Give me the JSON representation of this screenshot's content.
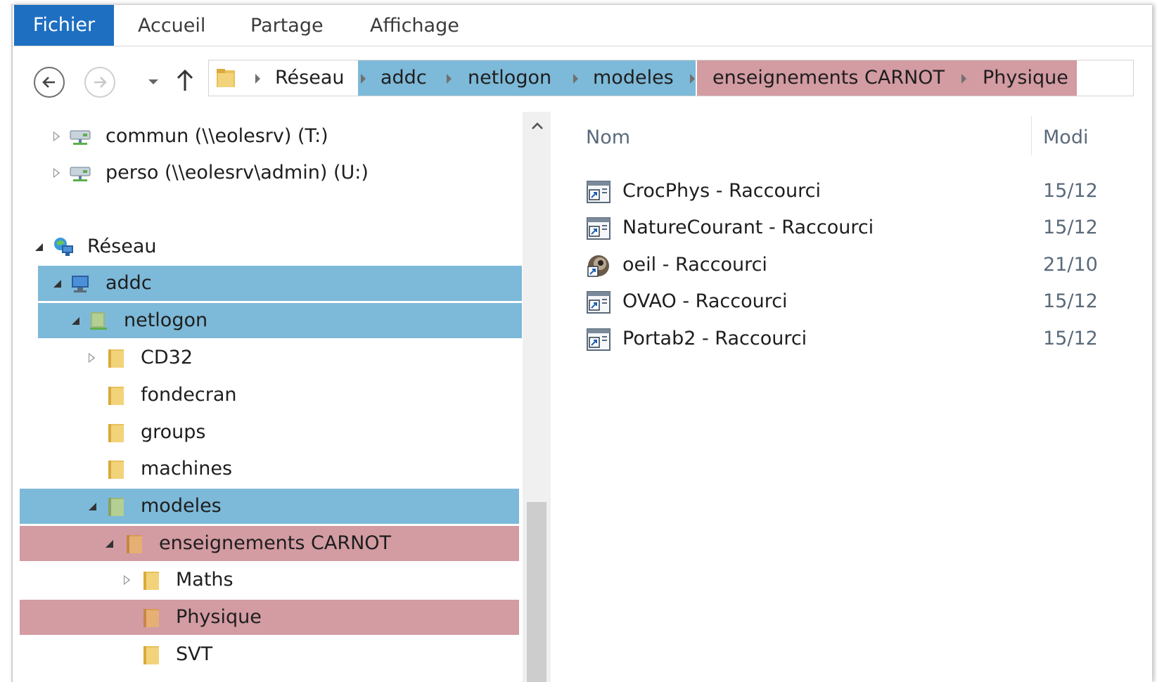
{
  "ribbon": {
    "tabs": [
      {
        "label": "Fichier"
      },
      {
        "label": "Accueil"
      },
      {
        "label": "Partage"
      },
      {
        "label": "Affichage"
      }
    ]
  },
  "address": {
    "crumbs": [
      "Réseau",
      "addc",
      "netlogon",
      "modeles",
      "enseignements CARNOT",
      "Physique"
    ]
  },
  "tree": {
    "items": [
      {
        "label": "commun (\\\\eolesrv) (T:)"
      },
      {
        "label": "perso (\\\\eolesrv\\admin) (U:)"
      },
      {
        "label": "Réseau"
      },
      {
        "label": "addc"
      },
      {
        "label": "netlogon"
      },
      {
        "label": "CD32"
      },
      {
        "label": "fondecran"
      },
      {
        "label": "groups"
      },
      {
        "label": "machines"
      },
      {
        "label": "modeles"
      },
      {
        "label": "enseignements CARNOT"
      },
      {
        "label": "Maths"
      },
      {
        "label": "Physique"
      },
      {
        "label": "SVT"
      }
    ]
  },
  "list": {
    "columns": [
      {
        "label": "Nom"
      },
      {
        "label": "Modi"
      }
    ],
    "rows": [
      {
        "name": "CrocPhys - Raccourci",
        "date": "15/12",
        "icon": "shortcut-icon"
      },
      {
        "name": "NatureCourant - Raccourci",
        "date": "15/12",
        "icon": "shortcut-icon"
      },
      {
        "name": "oeil - Raccourci",
        "date": "21/10",
        "icon": "eye-shortcut-icon"
      },
      {
        "name": "OVAO - Raccourci",
        "date": "15/12",
        "icon": "shortcut-icon"
      },
      {
        "name": "Portab2 - Raccourci",
        "date": "15/12",
        "icon": "shortcut-icon"
      }
    ]
  },
  "colors": {
    "file_tab": "#1e6fc2",
    "highlight_blue": "#7db9d8",
    "highlight_red": "#d39ba2",
    "folder_yellow": "#e8c15a"
  }
}
